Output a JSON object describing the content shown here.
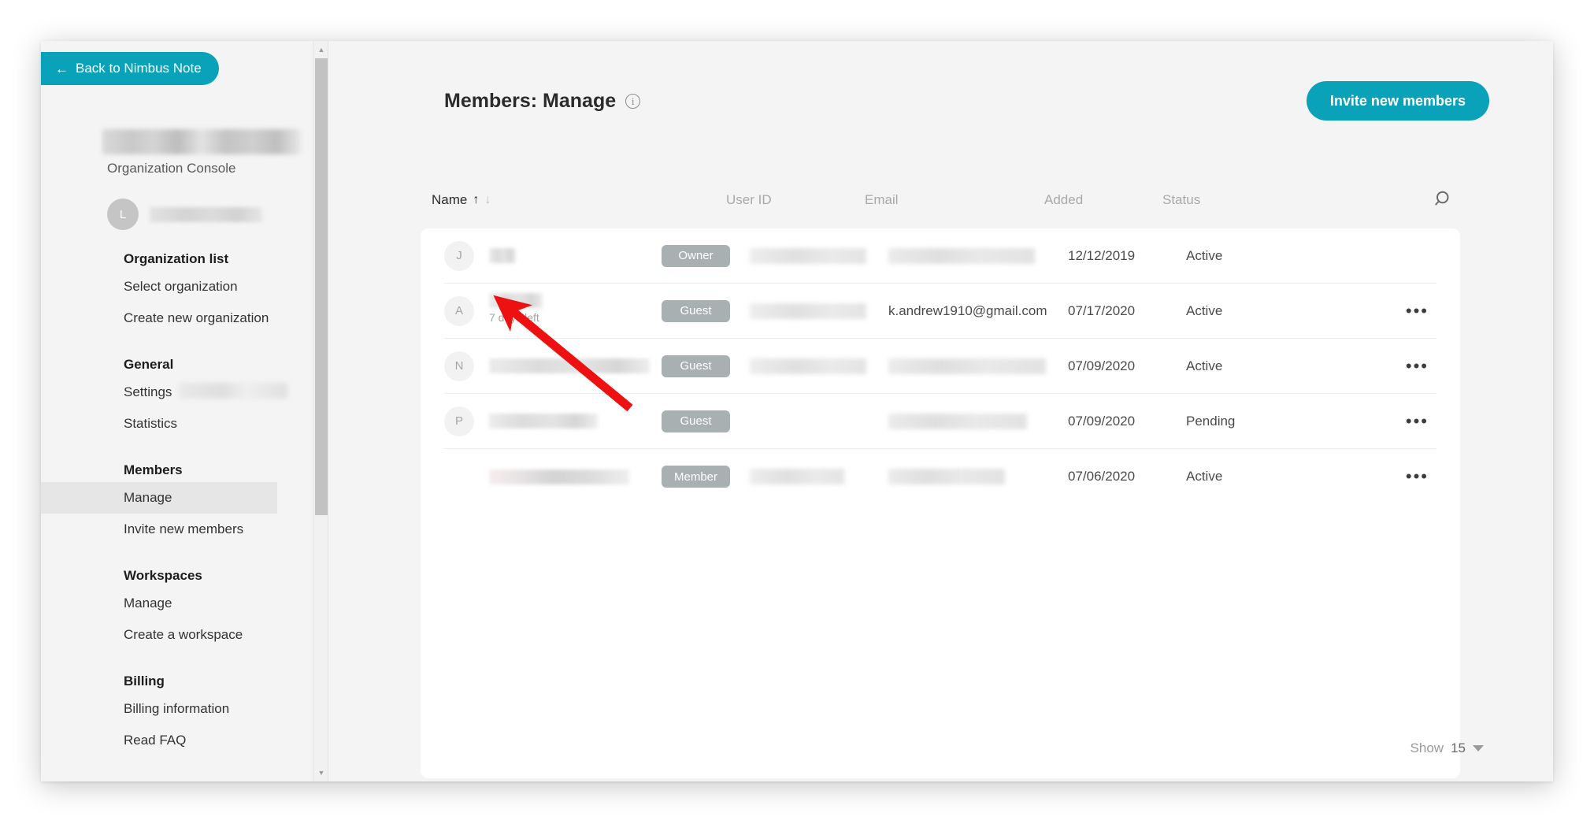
{
  "sidebar": {
    "back_button": {
      "label": "Back to Nimbus Note",
      "icon": "arrow-left-icon"
    },
    "org_console_label": "Organization Console",
    "avatar_initial": "L",
    "sections": [
      {
        "heading": "Organization list",
        "items": [
          "Select organization",
          "Create new organization"
        ]
      },
      {
        "heading": "General",
        "items": [
          "Settings",
          "Statistics"
        ]
      },
      {
        "heading": "Members",
        "items": [
          "Manage",
          "Invite new members"
        ],
        "active_item": "Manage"
      },
      {
        "heading": "Workspaces",
        "items": [
          "Manage",
          "Create a workspace"
        ]
      },
      {
        "heading": "Billing",
        "items": [
          "Billing information",
          "Read FAQ"
        ]
      }
    ]
  },
  "header": {
    "title": "Members: Manage",
    "info_icon": "info-circle-icon",
    "invite_button": "Invite new members"
  },
  "table": {
    "search_icon": "search-icon",
    "columns": {
      "name": "Name",
      "user_id": "User ID",
      "email": "Email",
      "added": "Added",
      "status": "Status"
    },
    "sort_asc_glyph": "↑",
    "sort_desc_glyph": "↓",
    "rows": [
      {
        "avatar_initial": "J",
        "name": "",
        "name_redacted": true,
        "name_width": 34,
        "sub_label": "",
        "role": "Owner",
        "user_id": "",
        "user_id_redacted": true,
        "user_id_width": 148,
        "email": "",
        "email_redacted": true,
        "email_width": 186,
        "added": "12/12/2019",
        "status": "Active",
        "has_more_menu": false
      },
      {
        "avatar_initial": "A",
        "name": "",
        "name_redacted": true,
        "name_width": 68,
        "sub_label": "7 days left",
        "role": "Guest",
        "user_id": "",
        "user_id_redacted": true,
        "user_id_width": 148,
        "email": "k.andrew1910@gmail.com",
        "email_redacted": false,
        "email_width": 0,
        "added": "07/17/2020",
        "status": "Active",
        "has_more_menu": true
      },
      {
        "avatar_initial": "N",
        "name": "",
        "name_redacted": true,
        "name_width": 204,
        "sub_label": "",
        "role": "Guest",
        "user_id": "",
        "user_id_redacted": true,
        "user_id_width": 148,
        "email": "",
        "email_redacted": true,
        "email_width": 200,
        "added": "07/09/2020",
        "status": "Active",
        "has_more_menu": true
      },
      {
        "avatar_initial": "P",
        "name": "",
        "name_redacted": true,
        "name_width": 138,
        "sub_label": "",
        "role": "Guest",
        "user_id": "",
        "user_id_redacted": false,
        "user_id_width": 0,
        "email": "",
        "email_redacted": true,
        "email_width": 176,
        "added": "07/09/2020",
        "status": "Pending",
        "has_more_menu": true
      },
      {
        "avatar_initial": "",
        "name": "",
        "name_redacted": true,
        "name_width": 178,
        "sub_label": "",
        "role": "Member",
        "user_id": "",
        "user_id_redacted": true,
        "user_id_width": 120,
        "email": "",
        "email_redacted": true,
        "email_width": 148,
        "added": "07/06/2020",
        "status": "Active",
        "has_more_menu": true
      }
    ]
  },
  "footer": {
    "show_label": "Show",
    "show_count": "15",
    "chevron_icon": "chevron-down-icon"
  },
  "colors": {
    "accent": "#0aa2b8",
    "badge": "#a8b0b2",
    "annotation": "#ee1111",
    "page_background": "#f4f4f4",
    "card_background": "#ffffff"
  }
}
